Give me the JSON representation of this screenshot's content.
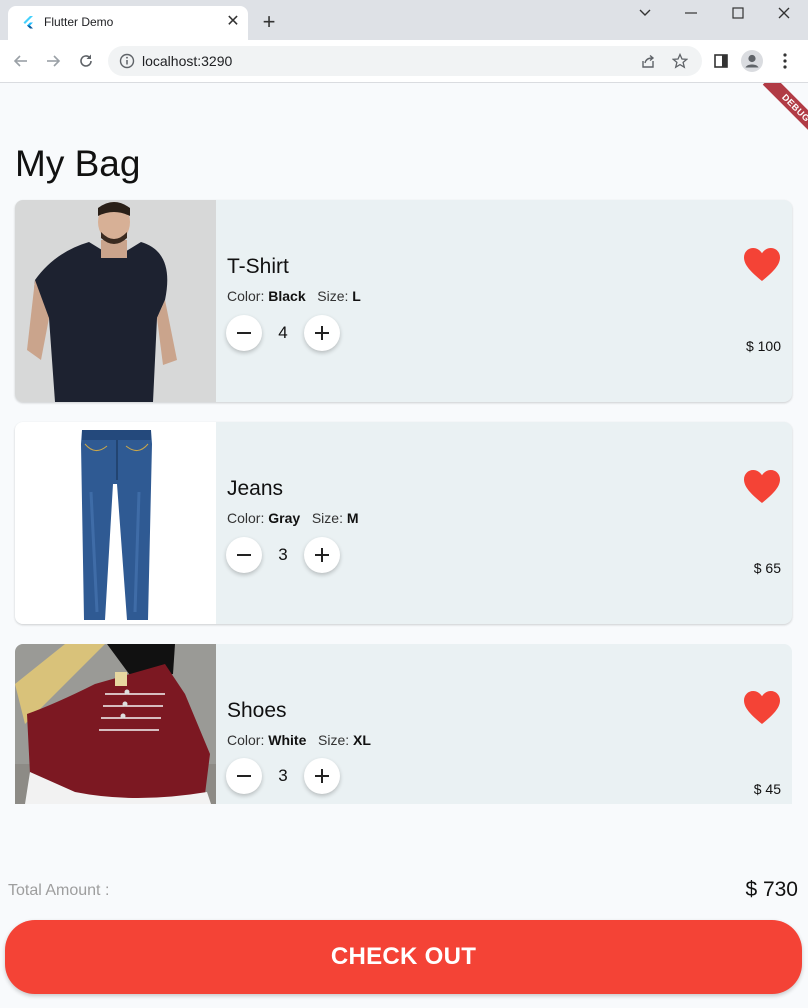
{
  "browser": {
    "tab_title": "Flutter Demo",
    "url": "localhost:3290"
  },
  "app": {
    "title": "My Bag",
    "debug_label": "DEBUG",
    "accent_color": "#f44336"
  },
  "items": [
    {
      "name": "T-Shirt",
      "color_label": "Color:",
      "color": "Black",
      "size_label": "Size:",
      "size": "L",
      "quantity": "4",
      "price": "$ 100",
      "favorite": true,
      "image": "t-shirt-photo"
    },
    {
      "name": "Jeans",
      "color_label": "Color:",
      "color": "Gray",
      "size_label": "Size:",
      "size": "M",
      "quantity": "3",
      "price": "$ 65",
      "favorite": true,
      "image": "jeans-photo"
    },
    {
      "name": "Shoes",
      "color_label": "Color:",
      "color": "White",
      "size_label": "Size:",
      "size": "XL",
      "quantity": "3",
      "price": "$ 45",
      "favorite": true,
      "image": "shoes-photo"
    }
  ],
  "summary": {
    "total_label": "Total Amount :",
    "total_value": "$ 730"
  },
  "checkout_label": "CHECK OUT"
}
